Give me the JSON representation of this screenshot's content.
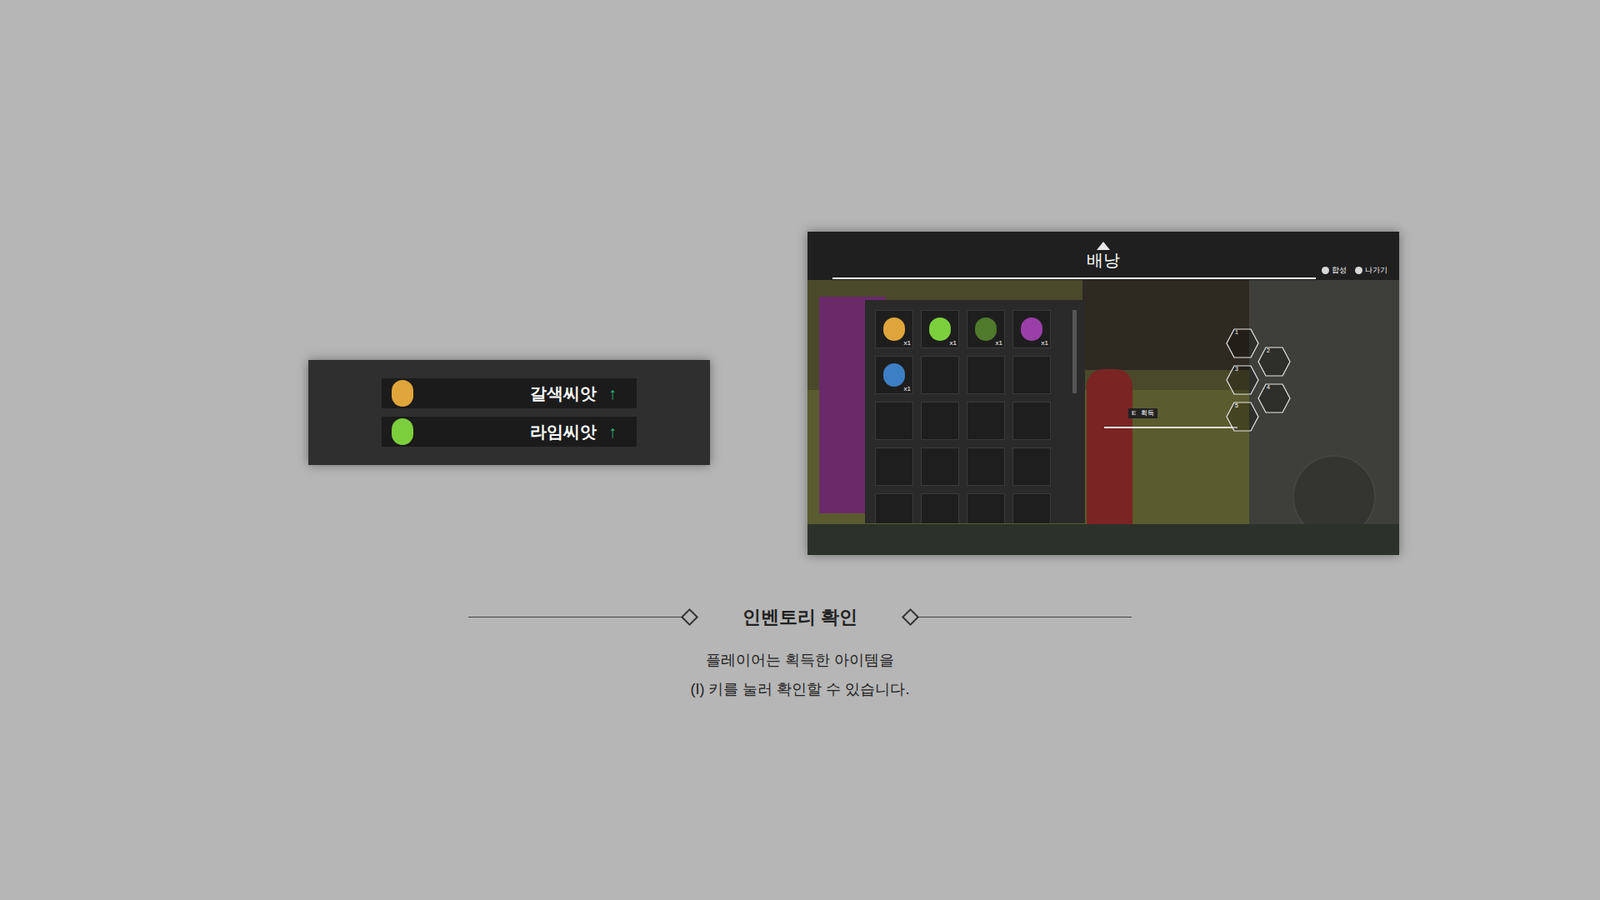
{
  "slide": {
    "title": "인벤토리 확인",
    "description": [
      "플레이어는 획득한 아이템을",
      "(I) 키를 눌러 확인할 수 있습니다."
    ]
  },
  "pickup_notifications": [
    {
      "name": "갈색씨앗",
      "arrow": "↑",
      "color": "#e0a53a"
    },
    {
      "name": "라임씨앗",
      "arrow": "↑",
      "color": "#7ccf3c"
    }
  ],
  "inventory": {
    "title": "배낭",
    "hints": [
      "합성",
      "나가기"
    ],
    "slots": [
      {
        "empty": false,
        "count": "x1",
        "color": "#e0a53a"
      },
      {
        "empty": false,
        "count": "x1",
        "color": "#7ccf3c"
      },
      {
        "empty": false,
        "count": "x1",
        "color": "#4f7a2c"
      },
      {
        "empty": false,
        "count": "x1",
        "color": "#9a3fa8"
      },
      {
        "empty": false,
        "count": "x1",
        "color": "#3d7fc4"
      },
      {
        "empty": true
      },
      {
        "empty": true
      },
      {
        "empty": true
      },
      {
        "empty": true
      },
      {
        "empty": true
      },
      {
        "empty": true
      },
      {
        "empty": true
      },
      {
        "empty": true
      },
      {
        "empty": true
      },
      {
        "empty": true
      },
      {
        "empty": true
      },
      {
        "empty": true
      },
      {
        "empty": true
      },
      {
        "empty": true
      },
      {
        "empty": true
      }
    ]
  },
  "quickslots": [
    "1",
    "2",
    "3",
    "4",
    "5"
  ],
  "prompt": {
    "key": "E",
    "label": "획득"
  }
}
